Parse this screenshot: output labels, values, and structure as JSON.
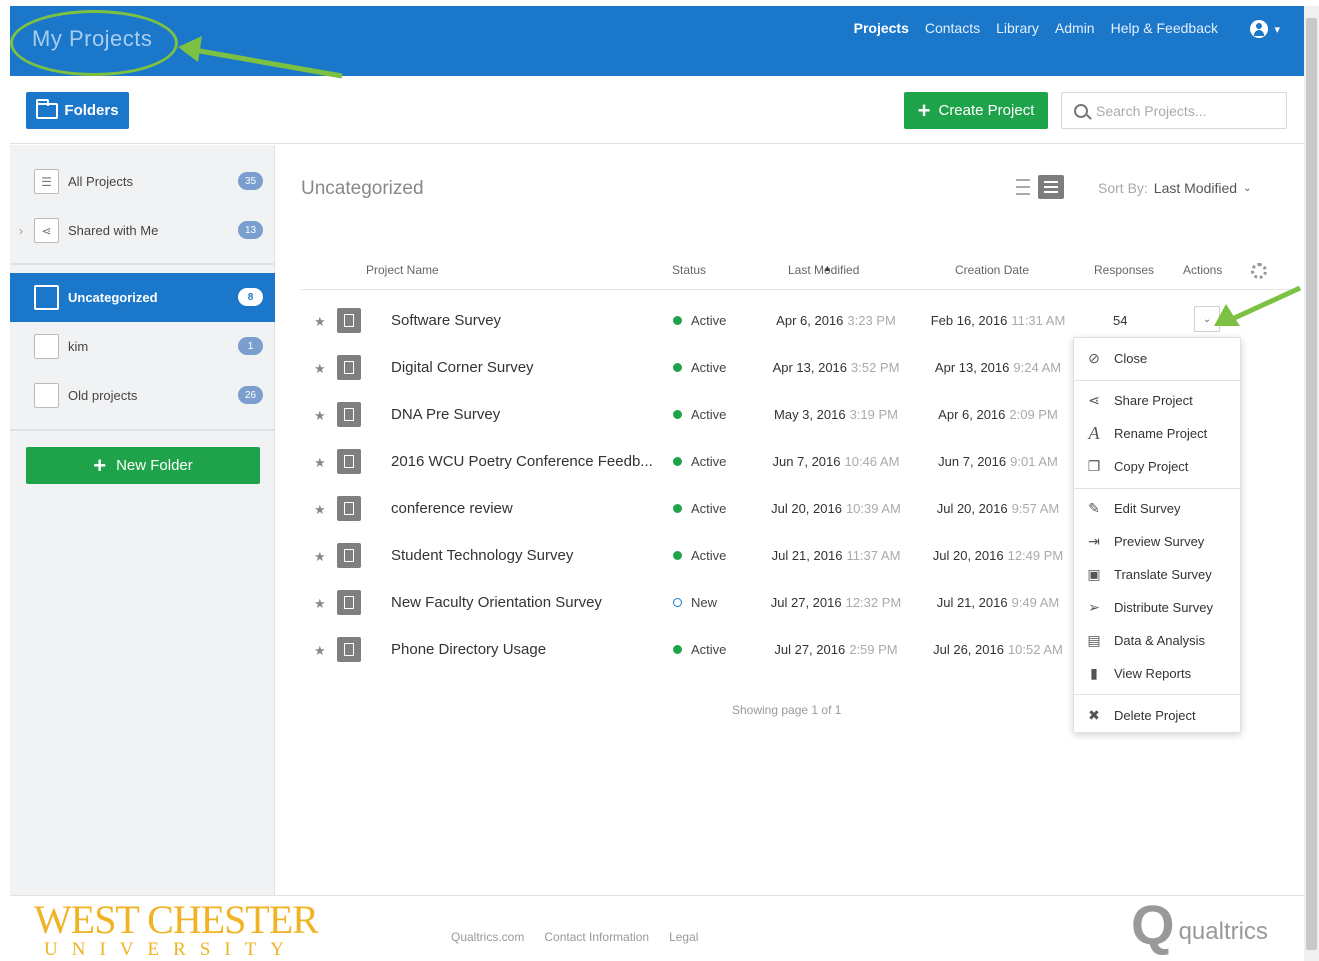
{
  "header": {
    "brand": "My Projects",
    "nav": [
      "Projects",
      "Contacts",
      "Library",
      "Admin",
      "Help & Feedback"
    ]
  },
  "toolbar": {
    "folders_label": "Folders",
    "create_label": "Create Project",
    "search_placeholder": "Search Projects..."
  },
  "sidebar": {
    "items": [
      {
        "label": "All Projects",
        "count": "35"
      },
      {
        "label": "Shared with Me",
        "count": "13"
      },
      {
        "label": "Uncategorized",
        "count": "8"
      },
      {
        "label": "kim",
        "count": "1"
      },
      {
        "label": "Old projects",
        "count": "26"
      }
    ],
    "new_folder_label": "New Folder"
  },
  "main": {
    "title": "Uncategorized",
    "sort_label": "Sort By:",
    "sort_value": "Last Modified",
    "columns": [
      "Project Name",
      "Status",
      "Last Modified",
      "Creation Date",
      "Responses",
      "Actions"
    ],
    "rows": [
      {
        "name": "Software Survey",
        "status": "Active",
        "lm_date": "Apr 6, 2016",
        "lm_time": "3:23 PM",
        "cd_date": "Feb 16, 2016",
        "cd_time": "11:31 AM",
        "responses": "54"
      },
      {
        "name": "Digital Corner Survey",
        "status": "Active",
        "lm_date": "Apr 13, 2016",
        "lm_time": "3:52 PM",
        "cd_date": "Apr 13, 2016",
        "cd_time": "9:24 AM",
        "responses": ""
      },
      {
        "name": "DNA Pre Survey",
        "status": "Active",
        "lm_date": "May 3, 2016",
        "lm_time": "3:19 PM",
        "cd_date": "Apr 6, 2016",
        "cd_time": "2:09 PM",
        "responses": ""
      },
      {
        "name": "2016 WCU Poetry Conference Feedb...",
        "status": "Active",
        "lm_date": "Jun 7, 2016",
        "lm_time": "10:46 AM",
        "cd_date": "Jun 7, 2016",
        "cd_time": "9:01 AM",
        "responses": ""
      },
      {
        "name": "conference review",
        "status": "Active",
        "lm_date": "Jul 20, 2016",
        "lm_time": "10:39 AM",
        "cd_date": "Jul 20, 2016",
        "cd_time": "9:57 AM",
        "responses": ""
      },
      {
        "name": "Student Technology Survey",
        "status": "Active",
        "lm_date": "Jul 21, 2016",
        "lm_time": "11:37 AM",
        "cd_date": "Jul 20, 2016",
        "cd_time": "12:49 PM",
        "responses": ""
      },
      {
        "name": "New Faculty Orientation Survey",
        "status": "New",
        "lm_date": "Jul 27, 2016",
        "lm_time": "12:32 PM",
        "cd_date": "Jul 21, 2016",
        "cd_time": "9:49 AM",
        "responses": ""
      },
      {
        "name": "Phone Directory Usage",
        "status": "Active",
        "lm_date": "Jul 27, 2016",
        "lm_time": "2:59 PM",
        "cd_date": "Jul 26, 2016",
        "cd_time": "10:52 AM",
        "responses": ""
      }
    ],
    "pager": "Showing page 1 of 1"
  },
  "actions_menu": {
    "items": [
      "Close",
      "Share Project",
      "Rename Project",
      "Copy Project",
      "Edit Survey",
      "Preview Survey",
      "Translate Survey",
      "Distribute Survey",
      "Data & Analysis",
      "View Reports",
      "Delete Project"
    ]
  },
  "footer": {
    "logo_top": "WEST CHESTER",
    "logo_bottom": "UNIVERSITY",
    "links": [
      "Qualtrics.com",
      "Contact Information",
      "Legal"
    ],
    "qualtrics_mark": "Q",
    "qualtrics_word": "qualtrics"
  },
  "colors": {
    "brand_blue": "#1a77c9",
    "action_green": "#1fa34a",
    "annotation_green": "#7cc142",
    "wcu_gold": "#f0b323"
  }
}
